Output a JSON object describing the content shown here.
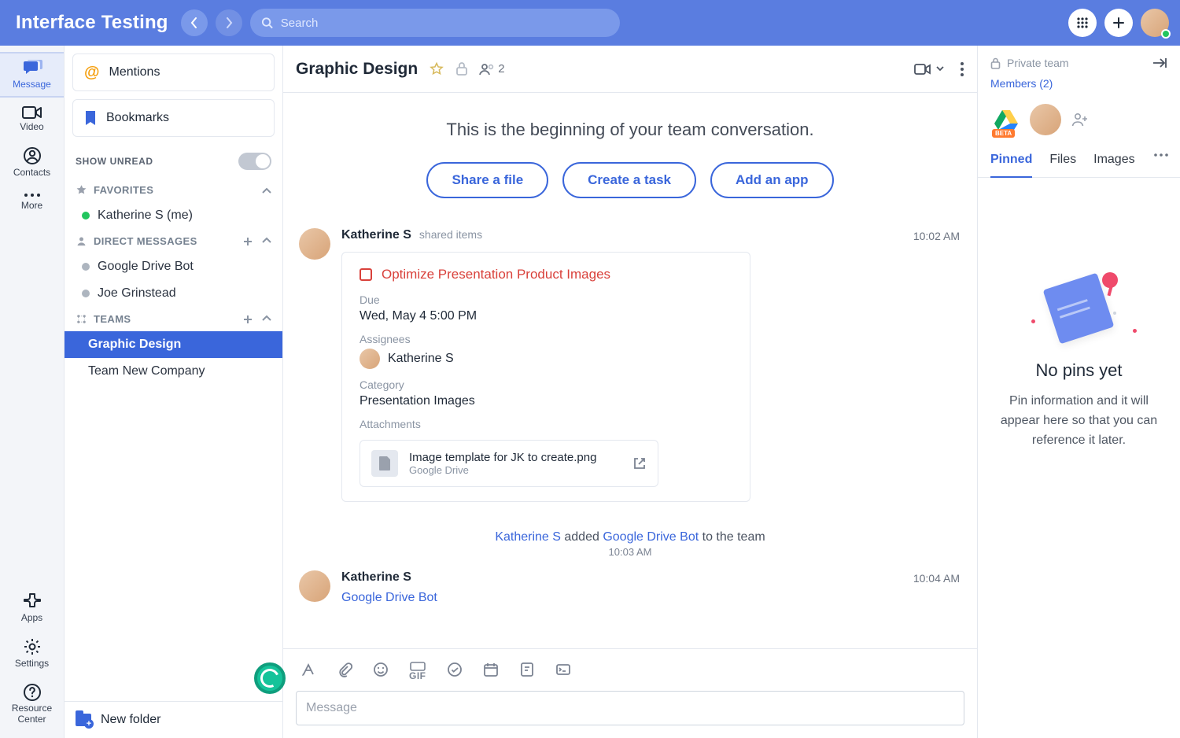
{
  "app_title": "Interface Testing",
  "search_placeholder": "Search",
  "rail": [
    {
      "label": "Message"
    },
    {
      "label": "Video"
    },
    {
      "label": "Contacts"
    },
    {
      "label": "More"
    },
    {
      "label": "Apps"
    },
    {
      "label": "Settings"
    },
    {
      "label": "Resource Center"
    }
  ],
  "sidebar": {
    "mentions": "Mentions",
    "bookmarks": "Bookmarks",
    "show_unread": "SHOW UNREAD",
    "favorites_label": "FAVORITES",
    "favorites": [
      {
        "name": "Katherine S (me)",
        "online": true
      }
    ],
    "dm_label": "DIRECT MESSAGES",
    "dms": [
      {
        "name": "Google Drive Bot"
      },
      {
        "name": "Joe Grinstead"
      }
    ],
    "teams_label": "TEAMS",
    "teams": [
      {
        "name": "Graphic Design",
        "selected": true
      },
      {
        "name": "Team New Company"
      }
    ],
    "new_folder": "New folder"
  },
  "header": {
    "title": "Graphic Design",
    "member_count": "2"
  },
  "beginning_text": "This is the beginning of your team conversation.",
  "pills": {
    "share": "Share a file",
    "task": "Create a task",
    "app": "Add an app"
  },
  "msg1": {
    "author": "Katherine S",
    "meta": "shared items",
    "time": "10:02 AM",
    "task": {
      "title": "Optimize Presentation Product Images",
      "due_label": "Due",
      "due": "Wed, May 4 5:00 PM",
      "assignees_label": "Assignees",
      "assignee": "Katherine S",
      "category_label": "Category",
      "category": "Presentation Images",
      "attach_label": "Attachments",
      "attach_name": "Image template for JK to create.png",
      "attach_src": "Google Drive"
    }
  },
  "system": {
    "user": "Katherine S",
    "verb": " added ",
    "bot": "Google Drive Bot",
    "rest": " to the team",
    "time": "10:03 AM"
  },
  "msg2": {
    "author": "Katherine S",
    "time": "10:04 AM",
    "link": "Google Drive Bot"
  },
  "compose_placeholder": "Message",
  "right": {
    "private": "Private team",
    "members": "Members (2)",
    "tabs": {
      "pinned": "Pinned",
      "files": "Files",
      "images": "Images"
    },
    "empty_title": "No pins yet",
    "empty_sub": "Pin information and it will appear here so that you can reference it later."
  }
}
